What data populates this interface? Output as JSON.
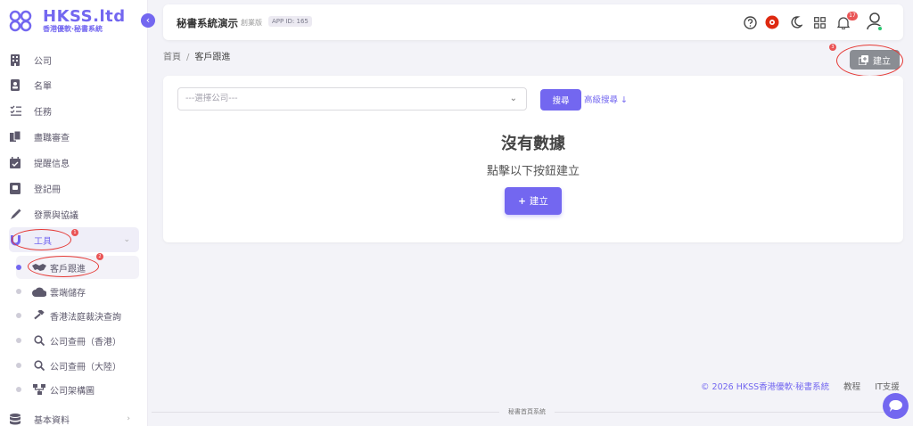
{
  "brand": {
    "title": "HKSS.ltd",
    "subtitle": "香港優軟·秘書系統"
  },
  "sidebar": {
    "items": [
      {
        "label": "公司",
        "icon": "building-icon"
      },
      {
        "label": "名單",
        "icon": "contact-card-icon"
      },
      {
        "label": "任務",
        "icon": "task-list-icon"
      },
      {
        "label": "盡職審查",
        "icon": "documents-icon"
      },
      {
        "label": "提醒信息",
        "icon": "calendar-check-icon"
      },
      {
        "label": "登記冊",
        "icon": "register-book-icon"
      },
      {
        "label": "發票與協議",
        "icon": "pen-icon"
      },
      {
        "label": "工具",
        "icon": "magnet-icon",
        "expanded": true,
        "badge": "1"
      }
    ],
    "subitems": [
      {
        "label": "客戶跟進",
        "icon": "handshake-icon",
        "active": true,
        "badge": "2"
      },
      {
        "label": "雲端儲存",
        "icon": "cloud-icon"
      },
      {
        "label": "香港法庭裁決查詢",
        "icon": "gavel-icon"
      },
      {
        "label": "公司查冊（香港）",
        "icon": "search-icon"
      },
      {
        "label": "公司查冊（大陸）",
        "icon": "search-icon"
      },
      {
        "label": "公司架構圖",
        "icon": "org-chart-icon"
      }
    ],
    "last_item": {
      "label": "基本資料",
      "icon": "database-icon"
    }
  },
  "header": {
    "app_name": "秘書系統演示",
    "edition": "創業版",
    "app_id": "APP ID: 165",
    "notification_count": "17"
  },
  "breadcrumb": {
    "home": "首頁",
    "separator": "/",
    "current": "客戶跟進"
  },
  "toolbar": {
    "create_label": "建立",
    "create_badge": "3"
  },
  "filter": {
    "select_placeholder": "---選擇公司---",
    "search_label": "搜尋",
    "advanced_search_label": "高級搜尋"
  },
  "empty_state": {
    "title": "沒有數據",
    "subtitle": "點擊以下按鈕建立",
    "button_label": "建立"
  },
  "footer": {
    "copyright": "© 2026 HKSS香港優軟·秘書系統",
    "tutorial": "教程",
    "support": "IT支援",
    "bottom_text": "秘書首頁系統"
  },
  "colors": {
    "accent": "#7367f0",
    "danger": "#ea5455",
    "annotation": "#e53935"
  }
}
